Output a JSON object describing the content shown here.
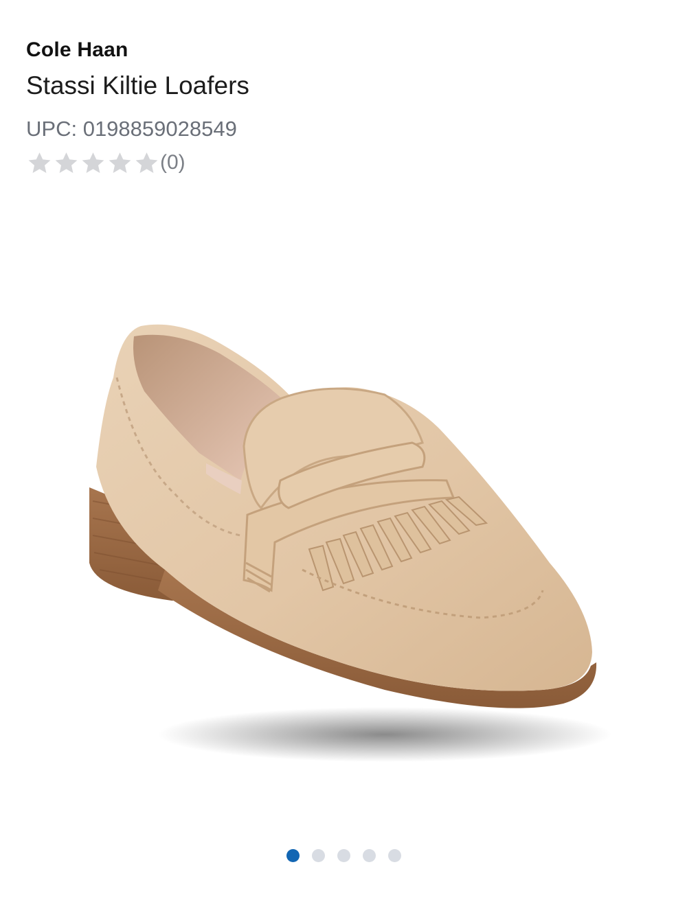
{
  "product": {
    "brand": "Cole Haan",
    "name": "Stassi Kiltie Loafers",
    "upc_label": "UPC:",
    "upc_value": "0198859028549",
    "rating": {
      "stars_filled": 0,
      "stars_total": 5,
      "review_count": "(0)",
      "star_color_empty": "#d4d5d8"
    },
    "image": {
      "icon": "product-photo-loafer"
    }
  },
  "carousel": {
    "active_index": 0,
    "total": 5,
    "active_color": "#1266b3",
    "inactive_color": "#d8dce3"
  }
}
